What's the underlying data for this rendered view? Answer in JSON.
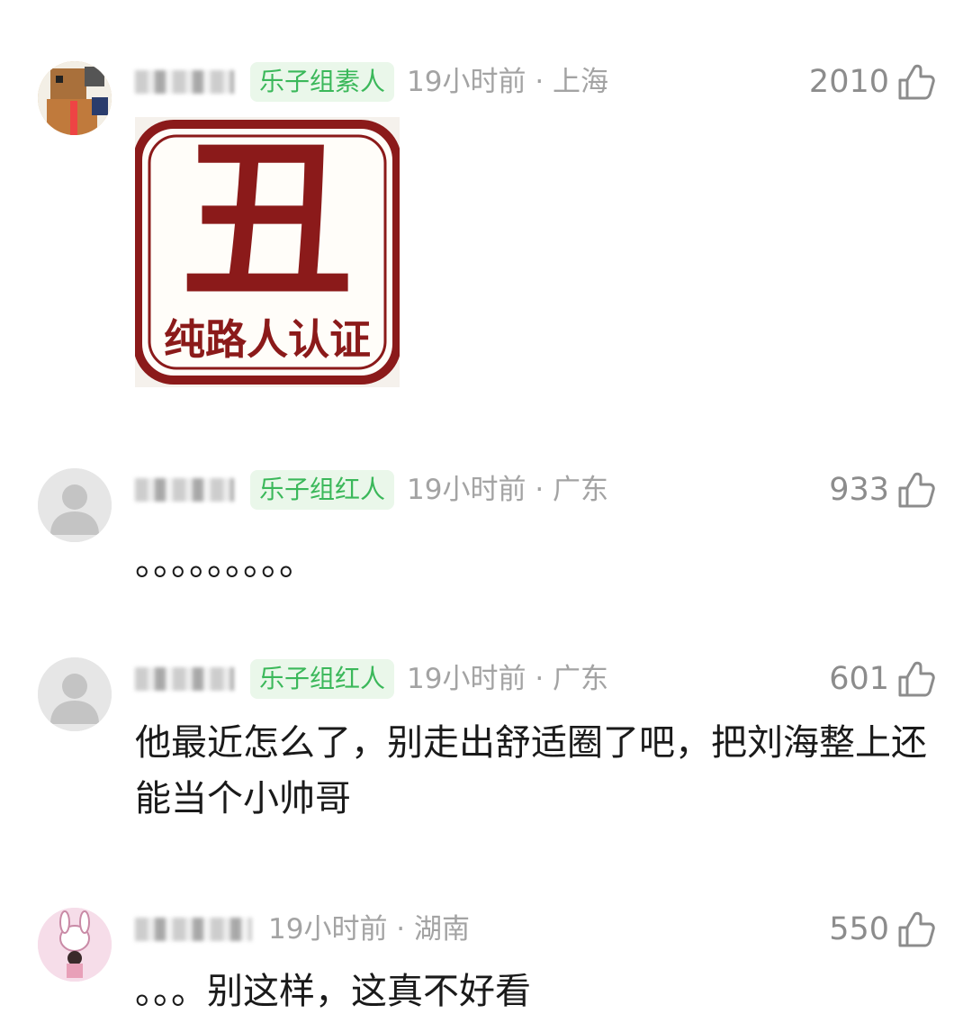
{
  "colors": {
    "badge_text": "#3bb85a",
    "badge_bg": "#eaf7ea",
    "meta_text": "#a3a3a3",
    "stamp_red": "#8b1a1a"
  },
  "comments": [
    {
      "badge": "乐子组素人",
      "time": "19小时前 · 上海",
      "likes": "2010",
      "stamp": {
        "big_char": "丑",
        "caption": "纯路人认证"
      }
    },
    {
      "badge": "乐子组红人",
      "time": "19小时前 · 广东",
      "likes": "933",
      "text": "。。。。。。。。。"
    },
    {
      "badge": "乐子组红人",
      "time": "19小时前 · 广东",
      "likes": "601",
      "text": "他最近怎么了，别走出舒适圈了吧，把刘海整上还能当个小帅哥"
    },
    {
      "time": "19小时前 · 湖南",
      "likes": "550",
      "text": "。。。别这样，这真不好看"
    }
  ],
  "icons": {
    "like": "thumbs-up-icon",
    "default_avatar": "person-silhouette-icon"
  }
}
